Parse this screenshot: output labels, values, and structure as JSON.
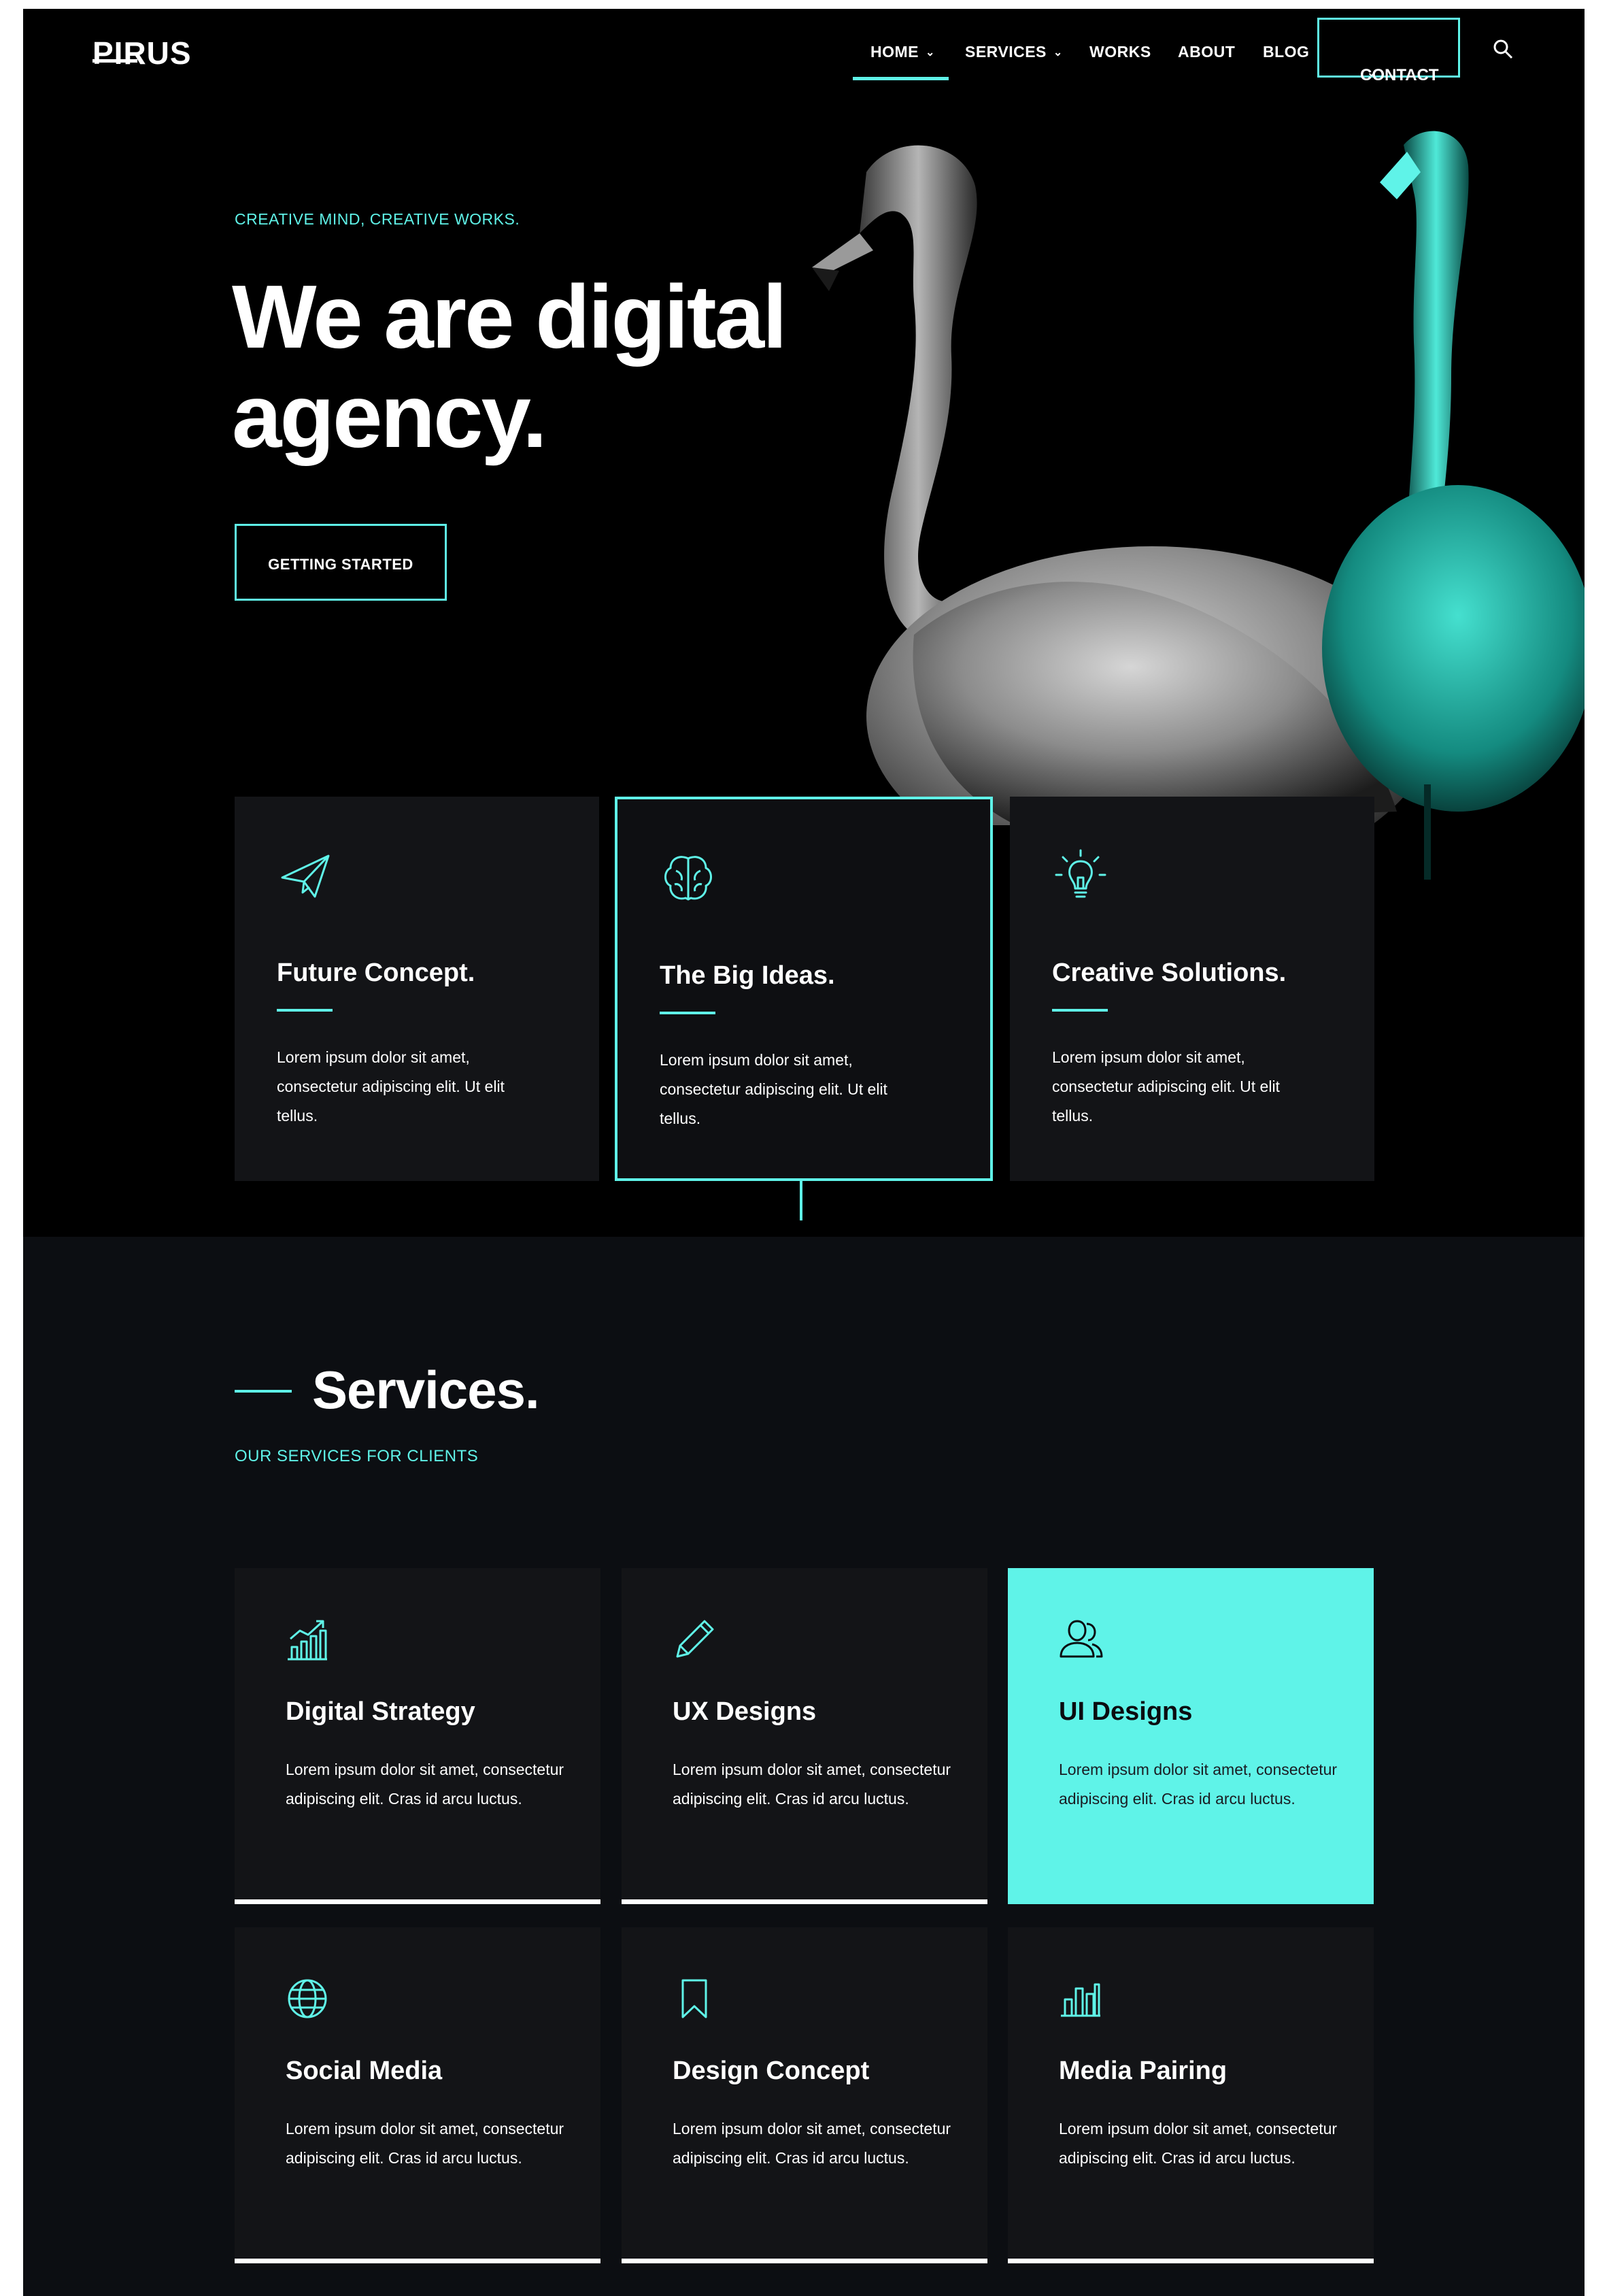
{
  "colors": {
    "accent": "#5ff3e8",
    "hero_bg": "#000000",
    "page_bg": "#0c0e12",
    "card_bg": "#131417",
    "text": "#ffffff"
  },
  "header": {
    "logo": "PIRUS",
    "nav": [
      {
        "label": "HOME",
        "dropdown": true,
        "active": true
      },
      {
        "label": "SERVICES",
        "dropdown": true
      },
      {
        "label": "WORKS"
      },
      {
        "label": "ABOUT"
      },
      {
        "label": "BLOG"
      },
      {
        "label": "CONTACT",
        "dropdown": true,
        "boxed": true
      }
    ],
    "search_icon": "search-icon"
  },
  "hero": {
    "tagline": "CREATIVE MIND, CREATIVE WORKS.",
    "headline": "We are digital agency.",
    "cta_label": "GETTING STARTED"
  },
  "features": [
    {
      "icon": "paper-plane-icon",
      "title": "Future Concept.",
      "text": "Lorem ipsum dolor sit amet, consectetur adipiscing elit. Ut elit tellus."
    },
    {
      "icon": "brain-icon",
      "title": "The Big Ideas.",
      "text": "Lorem ipsum dolor sit amet, consectetur adipiscing elit. Ut elit tellus.",
      "active": true
    },
    {
      "icon": "lightbulb-icon",
      "title": "Creative Solutions.",
      "text": "Lorem ipsum dolor sit amet, consectetur adipiscing elit. Ut elit tellus."
    }
  ],
  "services": {
    "title": "Services.",
    "subtitle": "OUR SERVICES FOR CLIENTS",
    "items": [
      {
        "icon": "growth-chart-icon",
        "title": "Digital Strategy",
        "text": "Lorem ipsum dolor sit amet, consectetur adipiscing elit. Cras id arcu luctus."
      },
      {
        "icon": "pencil-icon",
        "title": "UX Designs",
        "text": "Lorem ipsum dolor sit amet, consectetur adipiscing elit. Cras id arcu luctus."
      },
      {
        "icon": "users-icon",
        "title": "UI Designs",
        "text": "Lorem ipsum dolor sit amet, consectetur adipiscing elit. Cras id arcu luctus.",
        "active": true
      },
      {
        "icon": "globe-icon",
        "title": "Social Media",
        "text": "Lorem ipsum dolor sit amet, consectetur adipiscing elit. Cras id arcu luctus."
      },
      {
        "icon": "bookmark-icon",
        "title": "Design Concept",
        "text": "Lorem ipsum dolor sit amet, consectetur adipiscing elit. Cras id arcu luctus."
      },
      {
        "icon": "bar-chart-icon",
        "title": "Media Pairing",
        "text": "Lorem ipsum dolor sit amet, consectetur adipiscing elit. Cras id arcu luctus."
      }
    ]
  }
}
